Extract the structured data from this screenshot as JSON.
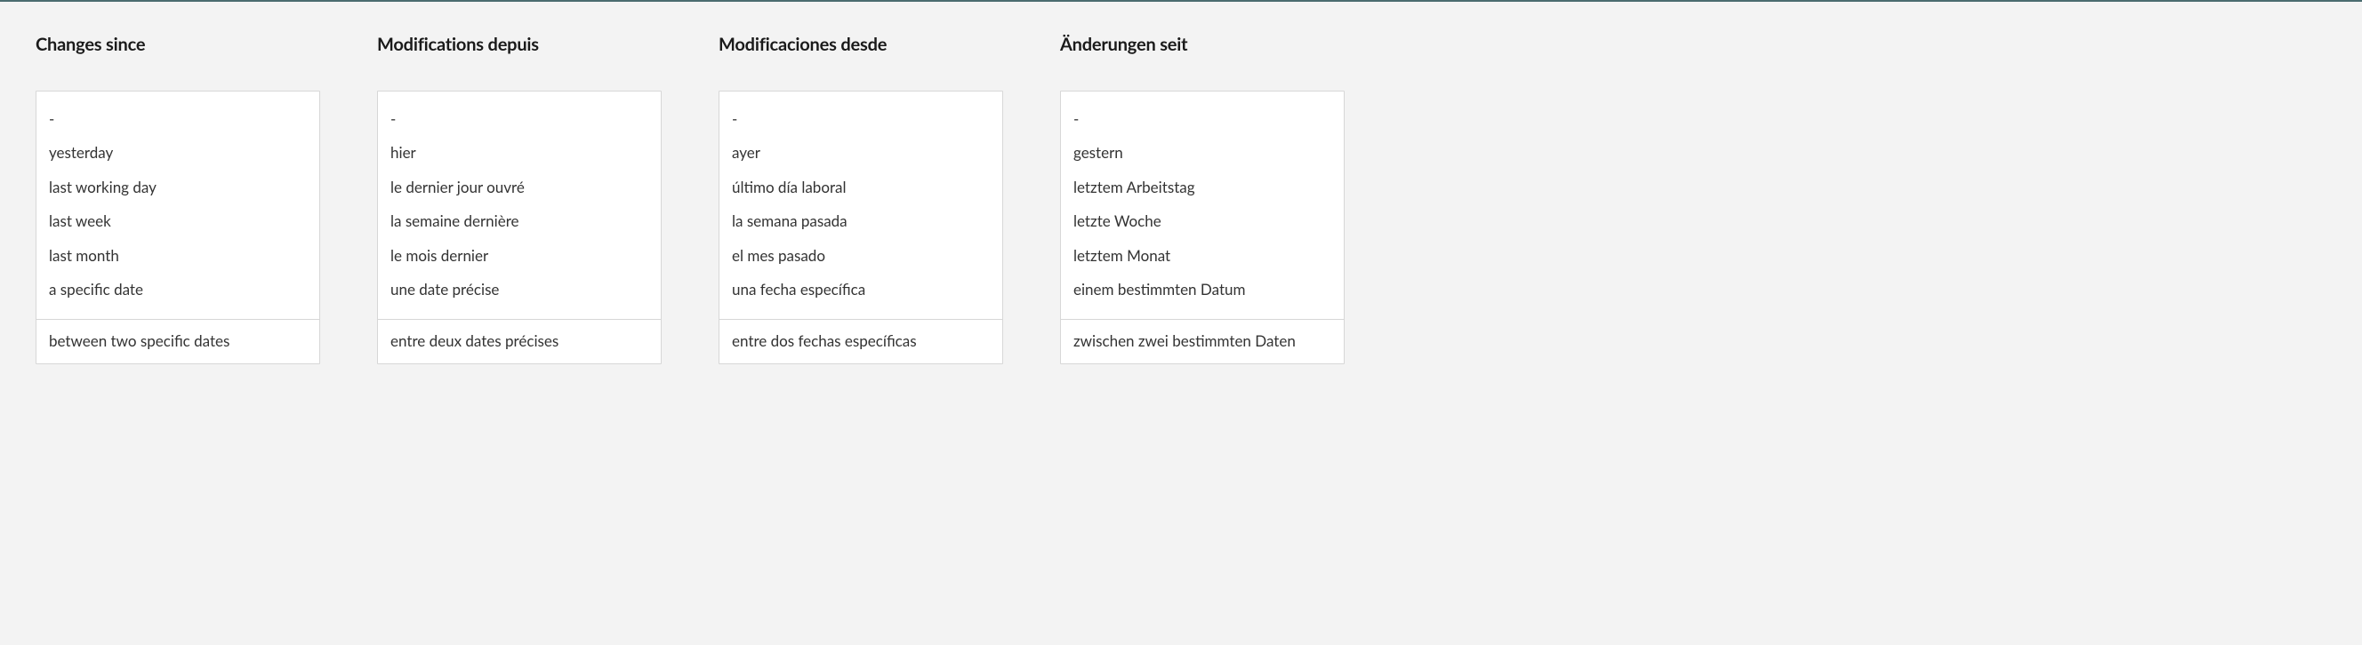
{
  "columns": [
    {
      "heading": "Changes since",
      "options": [
        "-",
        "yesterday",
        "last working day",
        "last week",
        "last month",
        "a specific date"
      ],
      "last": "between two specific dates"
    },
    {
      "heading": "Modifications depuis",
      "options": [
        "-",
        "hier",
        "le dernier jour ouvré",
        "la semaine dernière",
        "le mois dernier",
        "une date précise"
      ],
      "last": "entre deux dates précises"
    },
    {
      "heading": "Modificaciones desde",
      "options": [
        "-",
        "ayer",
        "último día laboral",
        "la semana pasada",
        "el mes pasado",
        "una fecha específica"
      ],
      "last": "entre dos fechas específicas"
    },
    {
      "heading": "Änderungen seit",
      "options": [
        "-",
        "gestern",
        "letztem Arbeitstag",
        "letzte Woche",
        "letztem Monat",
        "einem bestimmten Datum"
      ],
      "last": "zwischen zwei bestimmten Daten"
    }
  ]
}
